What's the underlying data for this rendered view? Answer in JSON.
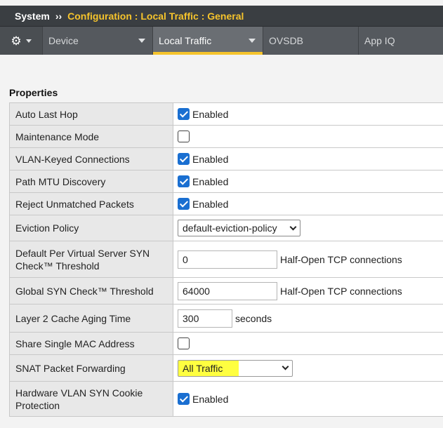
{
  "header": {
    "system": "System",
    "separator": "››",
    "breadcrumb": "Configuration : Local Traffic : General"
  },
  "tabs": [
    {
      "label": "",
      "icon": "gear-icon"
    },
    {
      "label": "Device"
    },
    {
      "label": "Local Traffic",
      "active": true
    },
    {
      "label": "OVSDB"
    },
    {
      "label": "App IQ"
    }
  ],
  "section": {
    "title": "Properties"
  },
  "rows": [
    {
      "label": "Auto Last Hop",
      "checked": true,
      "text": "Enabled"
    },
    {
      "label": "Maintenance Mode",
      "checked": false
    },
    {
      "label": "VLAN-Keyed Connections",
      "checked": true,
      "text": "Enabled"
    },
    {
      "label": "Path MTU Discovery",
      "checked": true,
      "text": "Enabled"
    },
    {
      "label": "Reject Unmatched Packets",
      "checked": true,
      "text": "Enabled"
    },
    {
      "label": "Eviction Policy",
      "select": "default-eviction-policy"
    },
    {
      "label": "Default Per Virtual Server SYN Check™ Threshold",
      "input": "0",
      "suffix": "Half-Open TCP connections"
    },
    {
      "label": "Global SYN Check™ Threshold",
      "input": "64000",
      "suffix": "Half-Open TCP connections"
    },
    {
      "label": "Layer 2 Cache Aging Time",
      "input": "300",
      "suffix": "seconds"
    },
    {
      "label": "Share Single MAC Address",
      "checked": false
    },
    {
      "label": "SNAT Packet Forwarding",
      "select": "All Traffic"
    },
    {
      "label": "Hardware VLAN SYN Cookie Protection",
      "checked": true,
      "text": "Enabled"
    }
  ],
  "colors": {
    "accent": "#f6c42c",
    "checkbox": "#1a6fd1",
    "highlight": "#ffff40"
  }
}
